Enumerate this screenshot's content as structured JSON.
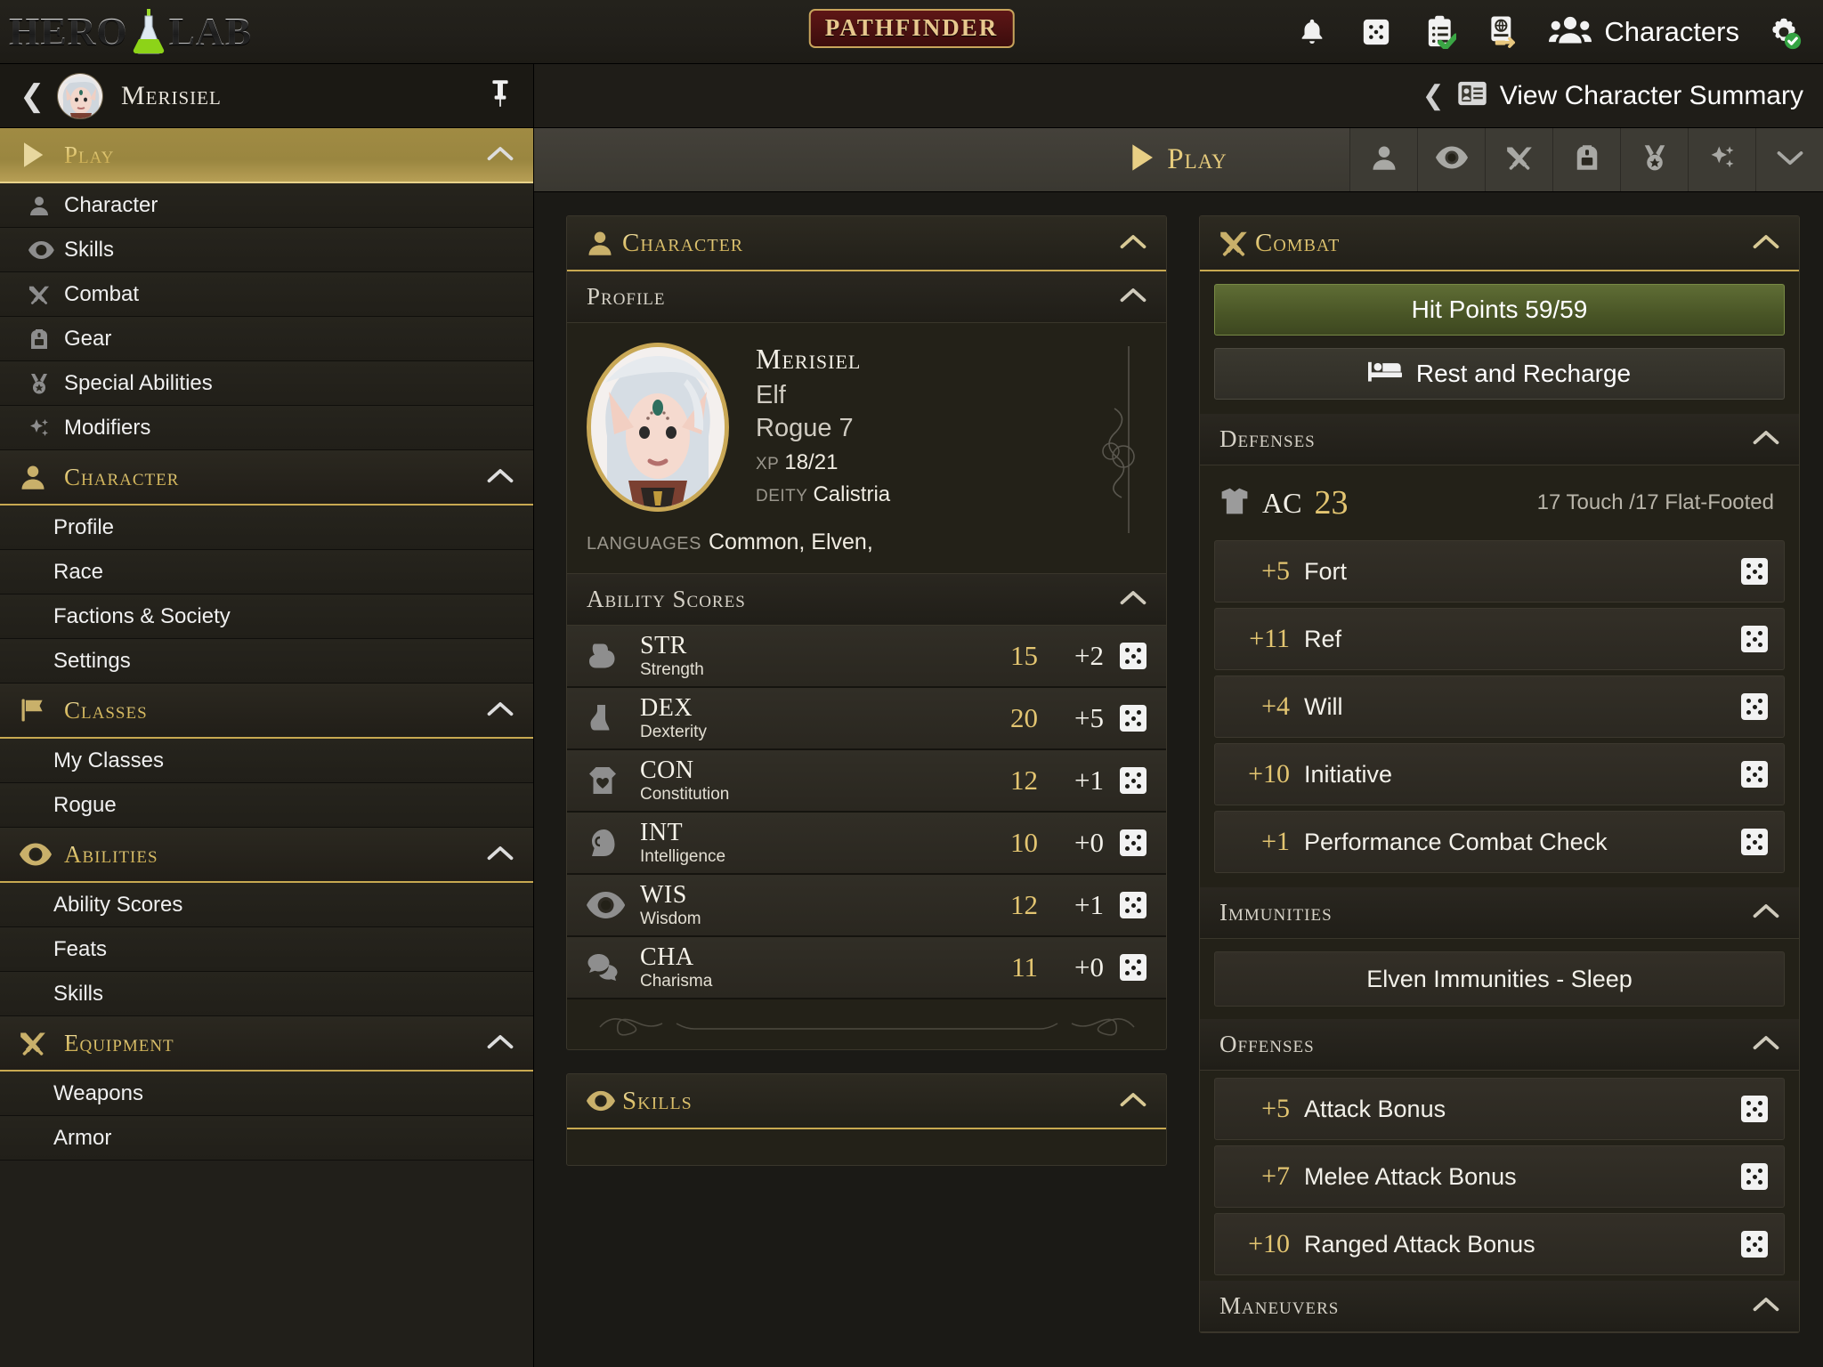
{
  "header": {
    "app_name": "HERO LAB",
    "game_logo": "PATHFINDER",
    "characters_label": "Characters",
    "icons": [
      "bell-icon",
      "dice-icon",
      "checklist-icon",
      "license-transfer-icon",
      "people-icon",
      "gear-icon"
    ]
  },
  "sidebar": {
    "character_name": "Merisiel",
    "sections": [
      {
        "label": "Play",
        "icon": "play-icon",
        "active": true,
        "items": [
          {
            "label": "Character",
            "icon": "person-icon"
          },
          {
            "label": "Skills",
            "icon": "eye-icon"
          },
          {
            "label": "Combat",
            "icon": "swords-icon"
          },
          {
            "label": "Gear",
            "icon": "backpack-icon"
          },
          {
            "label": "Special Abilities",
            "icon": "medal-icon"
          },
          {
            "label": "Modifiers",
            "icon": "sparkles-icon"
          }
        ]
      },
      {
        "label": "Character",
        "icon": "person-icon",
        "active": false,
        "items": [
          {
            "label": "Profile",
            "icon": ""
          },
          {
            "label": "Race",
            "icon": ""
          },
          {
            "label": "Factions & Society",
            "icon": ""
          },
          {
            "label": "Settings",
            "icon": ""
          }
        ]
      },
      {
        "label": "Classes",
        "icon": "flag-icon",
        "active": false,
        "items": [
          {
            "label": "My Classes",
            "icon": ""
          },
          {
            "label": "Rogue",
            "icon": ""
          }
        ]
      },
      {
        "label": "Abilities",
        "icon": "eye-icon",
        "active": false,
        "items": [
          {
            "label": "Ability Scores",
            "icon": ""
          },
          {
            "label": "Feats",
            "icon": ""
          },
          {
            "label": "Skills",
            "icon": ""
          }
        ]
      },
      {
        "label": "Equipment",
        "icon": "swords-icon",
        "active": false,
        "items": [
          {
            "label": "Weapons",
            "icon": ""
          },
          {
            "label": "Armor",
            "icon": ""
          }
        ]
      }
    ]
  },
  "main": {
    "summary_link": "View Character Summary",
    "play_tab": "Play",
    "play_tools": [
      "person-icon",
      "eye-icon",
      "swords-icon",
      "backpack-icon",
      "medal-icon",
      "sparkles-icon",
      "chevron-down-icon"
    ]
  },
  "character_panel": {
    "title": "Character",
    "profile": {
      "title": "Profile",
      "name": "Merisiel",
      "race": "Elf",
      "class_level": "Rogue 7",
      "xp_label": "XP",
      "xp_value": "18/21",
      "deity_label": "DEITY",
      "deity_value": "Calistria",
      "languages_label": "LANGUAGES",
      "languages_value": "Common, Elven,"
    },
    "ability_scores": {
      "title": "Ability Scores",
      "rows": [
        {
          "abbr": "STR",
          "full": "Strength",
          "score": "15",
          "mod": "+2",
          "icon": "muscle-icon"
        },
        {
          "abbr": "DEX",
          "full": "Dexterity",
          "score": "20",
          "mod": "+5",
          "icon": "boot-icon"
        },
        {
          "abbr": "CON",
          "full": "Constitution",
          "score": "12",
          "mod": "+1",
          "icon": "heart-shirt-icon"
        },
        {
          "abbr": "INT",
          "full": "Intelligence",
          "score": "10",
          "mod": "+0",
          "icon": "brain-icon"
        },
        {
          "abbr": "WIS",
          "full": "Wisdom",
          "score": "12",
          "mod": "+1",
          "icon": "eye-icon"
        },
        {
          "abbr": "CHA",
          "full": "Charisma",
          "score": "11",
          "mod": "+0",
          "icon": "speech-icon"
        }
      ]
    },
    "skills": {
      "title": "Skills"
    }
  },
  "combat_panel": {
    "title": "Combat",
    "hit_points": "Hit Points 59/59",
    "rest_and_recharge": "Rest and Recharge",
    "defenses": {
      "title": "Defenses",
      "ac_label": "AC",
      "ac_value": "23",
      "ac_detail": "17 Touch /17 Flat-Footed",
      "rows": [
        {
          "bonus": "+5",
          "name": "Fort"
        },
        {
          "bonus": "+11",
          "name": "Ref"
        },
        {
          "bonus": "+4",
          "name": "Will"
        },
        {
          "bonus": "+10",
          "name": "Initiative"
        },
        {
          "bonus": "+1",
          "name": "Performance Combat Check"
        }
      ]
    },
    "immunities": {
      "title": "Immunities",
      "rows": [
        "Elven Immunities - Sleep"
      ]
    },
    "offenses": {
      "title": "Offenses",
      "rows": [
        {
          "bonus": "+5",
          "name": "Attack Bonus"
        },
        {
          "bonus": "+7",
          "name": "Melee Attack Bonus"
        },
        {
          "bonus": "+10",
          "name": "Ranged Attack Bonus"
        }
      ]
    },
    "maneuvers": {
      "title": "Maneuvers"
    }
  },
  "colors": {
    "gold": "#c8a951",
    "gold_text": "#e3c571",
    "hp_green": "#5f6d35",
    "panel_bg": "#232118",
    "app_bg": "#1b1a16"
  }
}
